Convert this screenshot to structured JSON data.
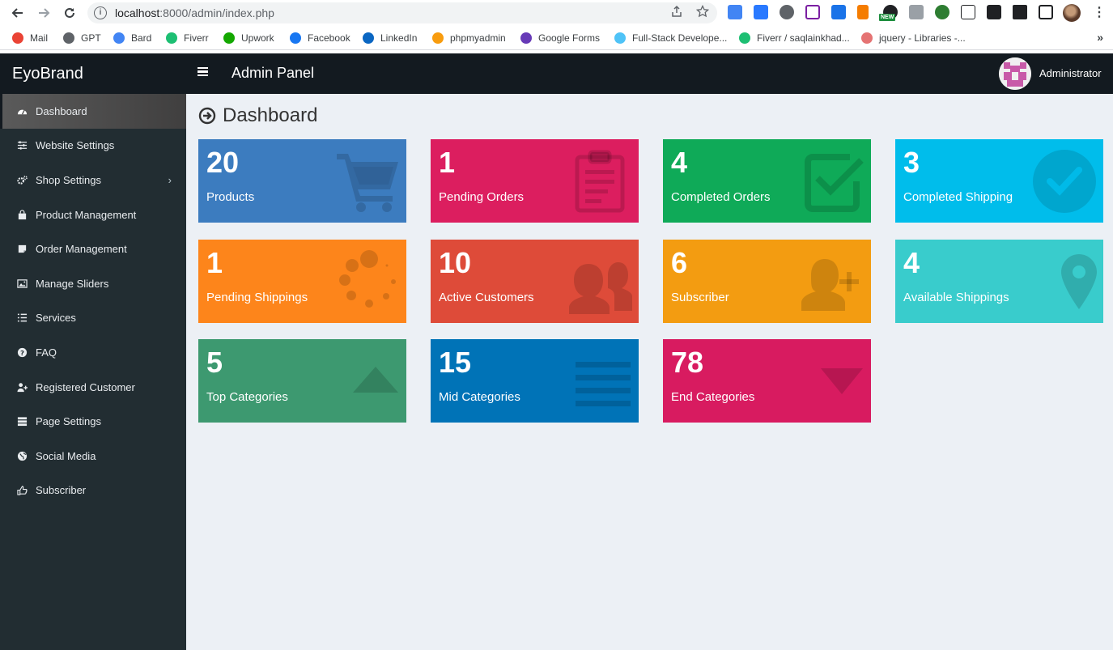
{
  "browser": {
    "url_host": "localhost",
    "url_rest": ":8000/admin/index.php",
    "ext_new_badge": "NEW",
    "bookmarks": [
      {
        "label": "Mail",
        "color": "#ea4335"
      },
      {
        "label": "GPT",
        "color": "#5f6368"
      },
      {
        "label": "Bard",
        "color": "#4285f4"
      },
      {
        "label": "Fiverr",
        "color": "#1dbf73"
      },
      {
        "label": "Upwork",
        "color": "#14a800"
      },
      {
        "label": "Facebook",
        "color": "#1877f2"
      },
      {
        "label": "LinkedIn",
        "color": "#0a66c2"
      },
      {
        "label": "phpmyadmin",
        "color": "#f89c0e"
      },
      {
        "label": "Google Forms",
        "color": "#673ab7"
      },
      {
        "label": "Full-Stack Develope...",
        "color": "#4fc3f7"
      },
      {
        "label": "Fiverr / saqlainkhad...",
        "color": "#1dbf73"
      },
      {
        "label": "jquery - Libraries -...",
        "color": "#e57373"
      }
    ],
    "bookmarks_more": "»"
  },
  "app": {
    "brand": "EyoBrand",
    "panel_title": "Admin Panel",
    "user_name": "Administrator",
    "page_title": "Dashboard"
  },
  "sidebar": {
    "items": [
      {
        "label": "Dashboard",
        "icon": "dashboard-icon",
        "active": true
      },
      {
        "label": "Website Settings",
        "icon": "sliders-icon"
      },
      {
        "label": "Shop Settings",
        "icon": "cogs-icon",
        "has_submenu": true
      },
      {
        "label": "Product Management",
        "icon": "shopping-bag-icon"
      },
      {
        "label": "Order Management",
        "icon": "sticky-note-icon"
      },
      {
        "label": "Manage Sliders",
        "icon": "picture-icon"
      },
      {
        "label": "Services",
        "icon": "list-icon"
      },
      {
        "label": "FAQ",
        "icon": "question-circle-icon"
      },
      {
        "label": "Registered Customer",
        "icon": "user-plus-icon"
      },
      {
        "label": "Page Settings",
        "icon": "tasks-icon"
      },
      {
        "label": "Social Media",
        "icon": "globe-icon"
      },
      {
        "label": "Subscriber",
        "icon": "hand-pointer-icon"
      }
    ]
  },
  "cards": [
    {
      "value": "20",
      "label": "Products",
      "color": "#3c7cbf",
      "icon": "cart-icon"
    },
    {
      "value": "1",
      "label": "Pending Orders",
      "color": "#dc1e5f",
      "icon": "clipboard-icon"
    },
    {
      "value": "4",
      "label": "Completed Orders",
      "color": "#0faa58",
      "icon": "check-square-icon"
    },
    {
      "value": "3",
      "label": "Completed Shipping",
      "color": "#00bdeb",
      "icon": "check-circle-icon"
    },
    {
      "value": "1",
      "label": "Pending Shippings",
      "color": "#fd851b",
      "icon": "spinner-icon"
    },
    {
      "value": "10",
      "label": "Active Customers",
      "color": "#de4b39",
      "icon": "users-icon"
    },
    {
      "value": "6",
      "label": "Subscriber",
      "color": "#f39c11",
      "icon": "user-plus-icon"
    },
    {
      "value": "4",
      "label": "Available Shippings",
      "color": "#39cccc",
      "icon": "map-marker-icon"
    },
    {
      "value": "5",
      "label": "Top Categories",
      "color": "#3d9970",
      "icon": "caret-up-icon"
    },
    {
      "value": "15",
      "label": "Mid Categories",
      "color": "#0073b7",
      "icon": "bars-icon"
    },
    {
      "value": "78",
      "label": "End Categories",
      "color": "#d81b60",
      "icon": "caret-down-icon"
    }
  ]
}
